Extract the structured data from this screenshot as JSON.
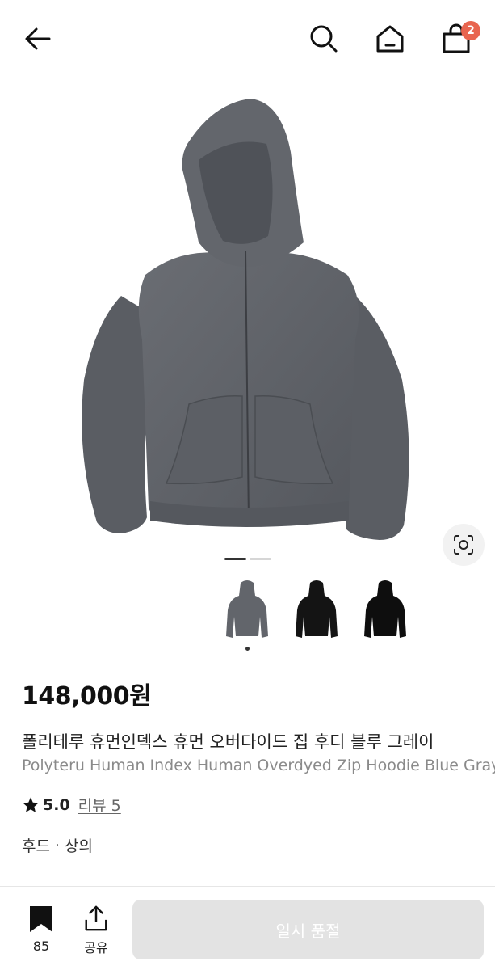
{
  "header": {
    "back_icon": "arrow-left-icon",
    "search_icon": "search-icon",
    "home_icon": "home-icon",
    "cart_icon": "shopping-bag-icon",
    "cart_count": "2"
  },
  "gallery": {
    "image_description": "gray zip hoodie",
    "lens_icon": "lens-search-icon",
    "pages": 2,
    "current_page": 1,
    "thumbnails": [
      {
        "color": "gray",
        "selected": true
      },
      {
        "color": "black",
        "selected": false
      },
      {
        "color": "black",
        "selected": false
      }
    ]
  },
  "product": {
    "price": "148,000원",
    "title_ko": "폴리테루 휴먼인덱스 휴먼 오버다이드 집 후디 블루 그레이",
    "title_en": "Polyteru Human Index Human Overdyed Zip Hoodie Blue Gray",
    "rating": "5.0",
    "reviews": "리뷰 5",
    "category_sub": "후드",
    "category_sep": "·",
    "category_main": "상의"
  },
  "bottom": {
    "bookmark_count": "85",
    "share_label": "공유",
    "status_button": "일시 품절"
  },
  "colors": {
    "badge": "#e8654f",
    "hoodie": "#5f6268",
    "disabled_button": "#e3e3e3"
  }
}
